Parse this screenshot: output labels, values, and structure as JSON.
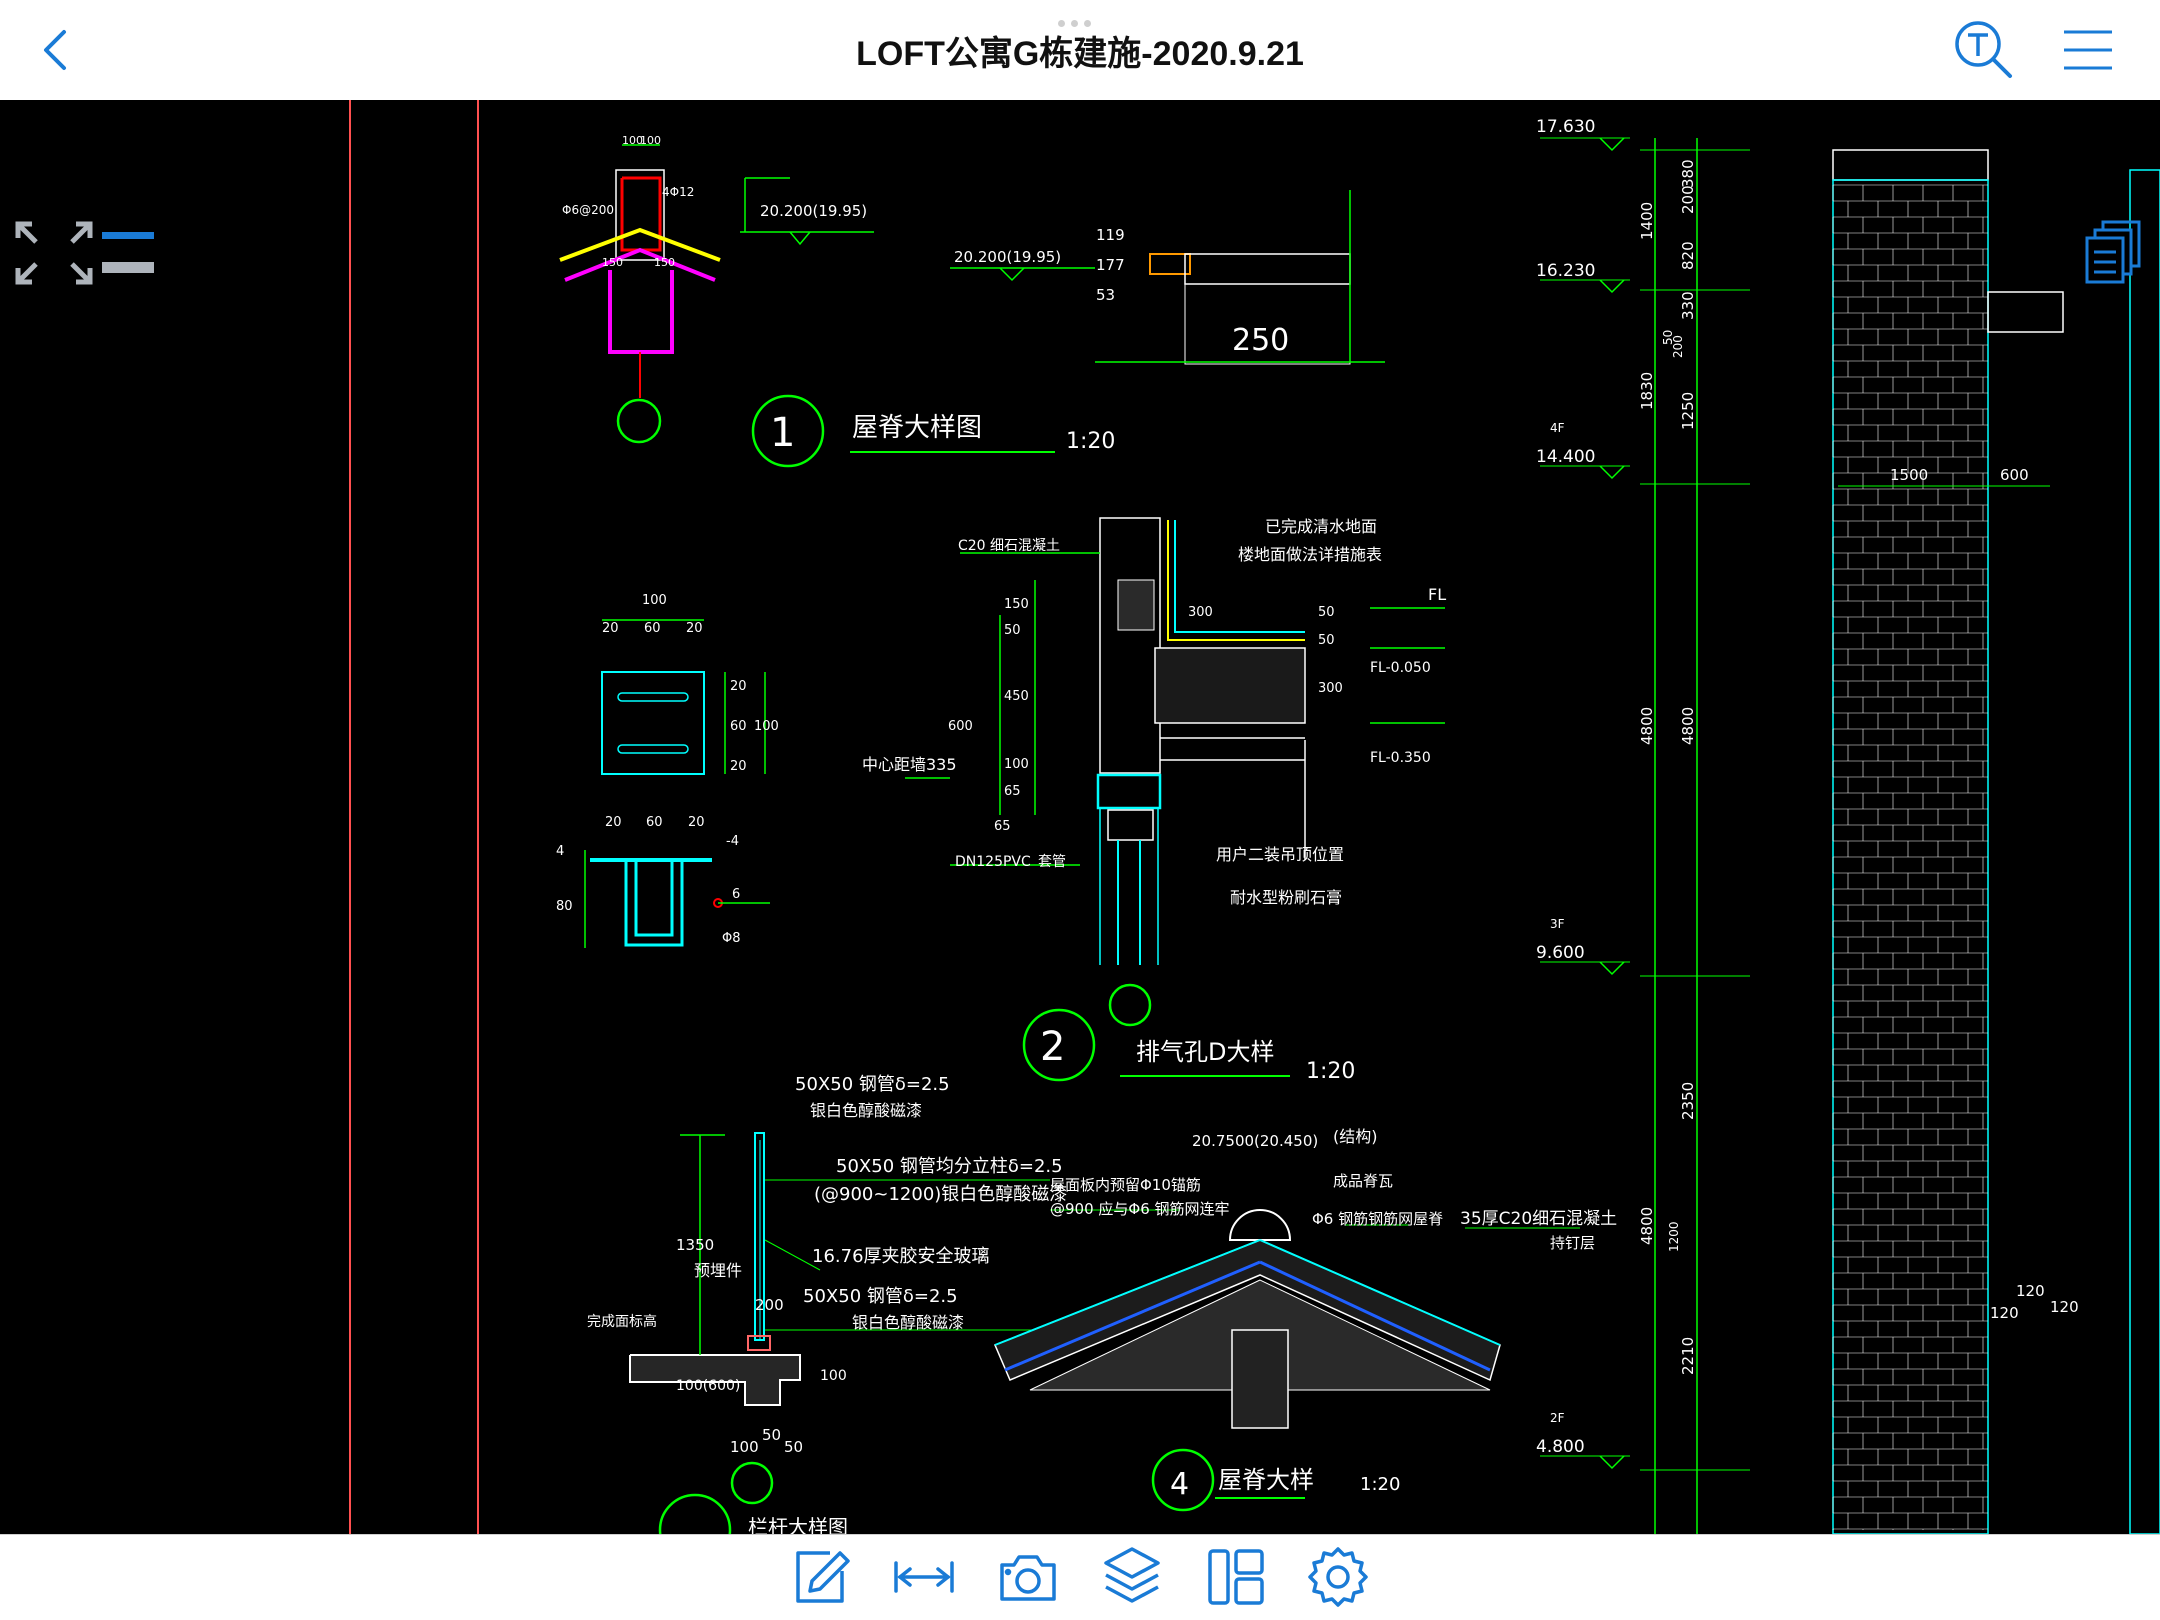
{
  "header": {
    "title": "LOFT公寓G栋建施-2020.9.21",
    "back_icon": "chevron-left-icon",
    "search_icon": "text-search-icon",
    "menu_icon": "hamburger-menu-icon"
  },
  "colors": {
    "accent": "#1a7bd6",
    "cad_green": "#00ff00",
    "cad_cyan": "#00ffff",
    "cad_white": "#ffffff",
    "cad_red": "#ff0000",
    "cad_magenta": "#ff00ff",
    "cad_yellow": "#ffff00"
  },
  "canvas_tools": {
    "expand_icon": "expand-arrows-icon",
    "layer_toggle_icon": "layer-lines-icon",
    "sheets_icon": "document-stack-icon"
  },
  "drawing": {
    "detail1": {
      "num": "1",
      "title": "屋脊大样图",
      "scale": "1:20",
      "dim1": "100",
      "dim2": "100",
      "elev": "20.200(19.95)",
      "rebar": "Φ6@200",
      "rebar2": "4Φ12",
      "w150a": "150",
      "w150b": "150",
      "elev2": "20.200(19.95)",
      "d53": "53",
      "d177": "177",
      "d119": "119",
      "d250": "250",
      "d250b": "250"
    },
    "detail_small": {
      "w100": "100",
      "w20a": "20",
      "w60": "60",
      "w20b": "20",
      "h20a": "20",
      "h60": "60",
      "h100": "100",
      "h20b": "20",
      "b20a": "20",
      "b60": "60",
      "b20b": "20",
      "t4": "4",
      "t4b": "-4",
      "h80": "80",
      "d6": "6",
      "phi8": "Φ8"
    },
    "detail2": {
      "num": "2",
      "title": "排气孔D大样",
      "scale": "1:20",
      "c20": "C20 细石混凝土",
      "finished": "已完成清水地面",
      "floor_note": "楼地面做法详措施表",
      "fl": "FL",
      "fl050": "FL-0.050",
      "fl350": "FL-0.350",
      "center": "中心距墙335",
      "dn": "DN125PVC",
      "sleeve": "套管",
      "ceiling": "用户二装吊顶位置",
      "gypsum": "耐水型粉刷石膏",
      "d150": "150",
      "d50": "50",
      "d450": "450",
      "d600": "600",
      "d100": "100",
      "d65": "65",
      "d65b": "65",
      "d300": "300",
      "d50b": "50",
      "d50c": "50",
      "d300b": "300"
    },
    "detail3": {
      "pipe1": "50X50 钢管δ=2.5",
      "paint1": "银白色醇酸磁漆",
      "post": "50X50 钢管均分立柱δ=2.5",
      "spacing": "(@900~1200)银白色醇酸磁漆",
      "glass": "16.76厚夹胶安全玻璃",
      "embed": "预埋件",
      "pipe2": "50X50 钢管δ=2.5",
      "paint2": "银白色醇酸磁漆",
      "floor": "完成面标高",
      "h1350": "1350",
      "h100_600": "100(600)",
      "w200": "200",
      "w100": "100",
      "w50": "50",
      "w50b": "50",
      "w100b": "100",
      "bottom_title": "栏杆大样图"
    },
    "detail4": {
      "num": "4",
      "title": "屋脊大样",
      "scale": "1:20",
      "elev": "20.7500(20.450)",
      "struct": "(结构)",
      "tile": "成品脊瓦",
      "rebar_note": "屋面板内预留Φ10锚筋",
      "rebar_note2": "@900 应与Φ6 钢筋网连牢",
      "mesh": "Φ6 钢筋钢筋网屋脊",
      "concrete": "35厚C20细石混凝土",
      "layer": "持钉层"
    },
    "elevation": {
      "levels": [
        {
          "value": "17.630",
          "floor": ""
        },
        {
          "value": "16.230",
          "floor": ""
        },
        {
          "value": "14.400",
          "floor": "4F"
        },
        {
          "value": "9.600",
          "floor": "3F"
        },
        {
          "value": "4.800",
          "floor": "2F"
        }
      ],
      "dims_outer": [
        "1400",
        "1830",
        "4800",
        "4800"
      ],
      "dims_inner": [
        "380",
        "200",
        "820",
        "330",
        "200",
        "50",
        "1250",
        "4800",
        "2350",
        "1200",
        "2210"
      ],
      "w1500": "1500",
      "w600": "600",
      "d120a": "120",
      "d120b": "120",
      "d120c": "120"
    }
  },
  "bottom_toolbar": [
    {
      "name": "annotate-pencil-icon"
    },
    {
      "name": "measure-distance-icon"
    },
    {
      "name": "camera-icon"
    },
    {
      "name": "layers-icon"
    },
    {
      "name": "layout-panel-icon"
    },
    {
      "name": "settings-gear-icon"
    }
  ]
}
